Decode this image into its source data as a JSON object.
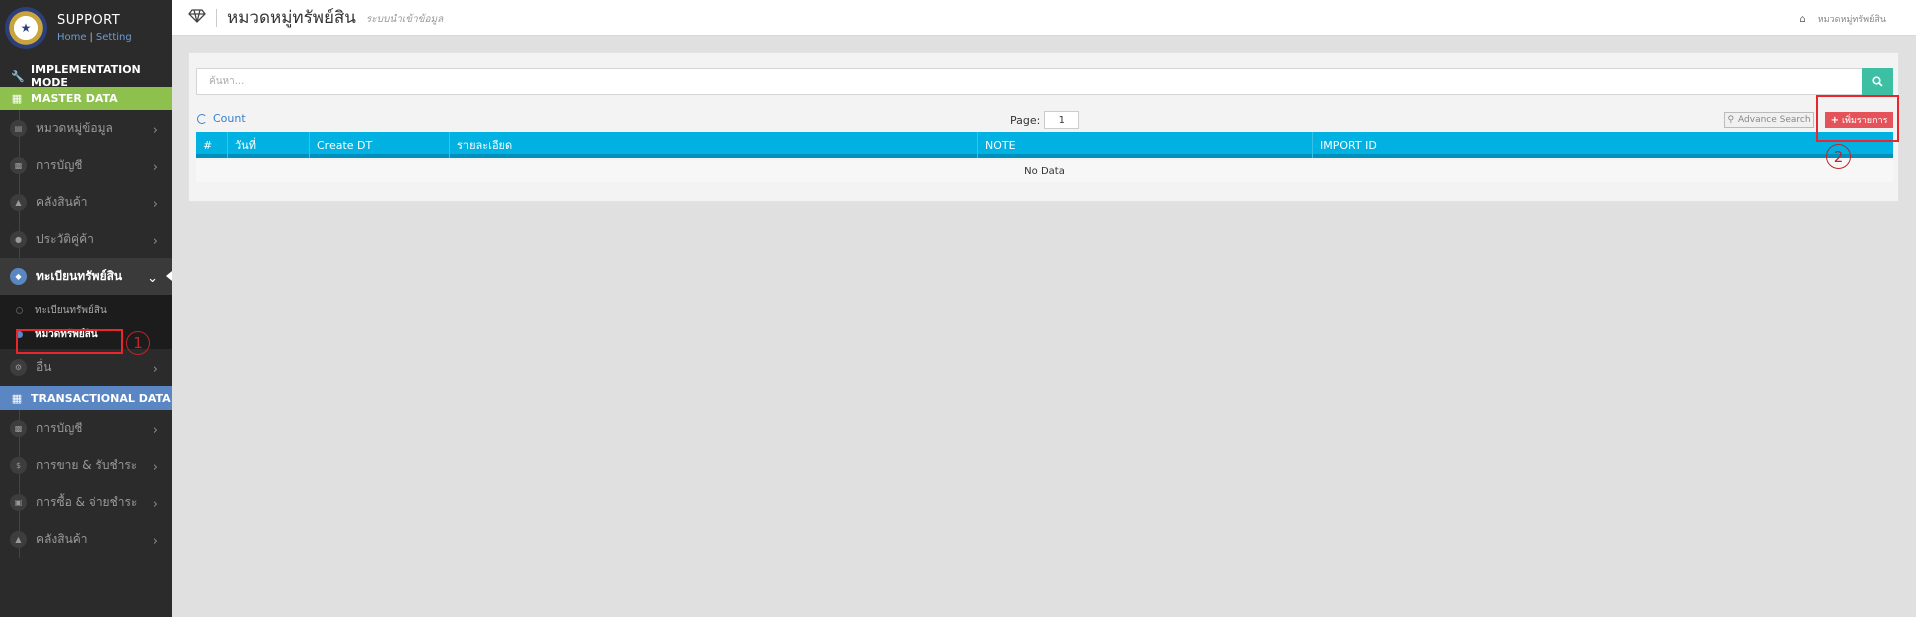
{
  "brand": {
    "title": "SUPPORT",
    "link_home": "Home",
    "link_setting": "Setting",
    "separator": "|"
  },
  "sidebar": {
    "implementation_label": "IMPLEMENTATION MODE",
    "master_label": "MASTER DATA",
    "master_items": [
      {
        "label": "หมวดหมู่ข้อมูล",
        "icon": "database-icon"
      },
      {
        "label": "การบัญชี",
        "icon": "book-icon"
      },
      {
        "label": "คลังสินค้า",
        "icon": "cubes-icon"
      },
      {
        "label": "ประวัติคู่ค้า",
        "icon": "user-icon"
      },
      {
        "label": "ทะเบียนทรัพย์สิน",
        "icon": "diamond-icon",
        "active": true
      }
    ],
    "submenu": [
      {
        "label": "ทะเบียนทรัพย์สิน"
      },
      {
        "label": "หมวดทรัพย์สิน",
        "current": true
      }
    ],
    "other_label": "อื่น",
    "transactional_label": "TRANSACTIONAL DATA",
    "trans_items": [
      {
        "label": "การบัญชี",
        "icon": "book-icon"
      },
      {
        "label": "การขาย & รับชำระ",
        "icon": "dollar-icon"
      },
      {
        "label": "การซื้อ & จ่ายชำระ",
        "icon": "cart-icon"
      },
      {
        "label": "คลังสินค้า",
        "icon": "cubes-icon"
      }
    ]
  },
  "header": {
    "title": "หมวดหมู่ทรัพย์สิน",
    "subtitle": "ระบบนำเข้าข้อมูล",
    "breadcrumb": "หมวดหมู่ทรัพย์สิน"
  },
  "toolbar": {
    "search_placeholder": "ค้นหา...",
    "count_label": "Count",
    "page_label": "Page:",
    "page_value": "1",
    "advance_search_label": "Advance Search",
    "add_label": "เพิ่มรายการ"
  },
  "table": {
    "columns": [
      "#",
      "วันที่",
      "Create DT",
      "รายละเอียด",
      "NOTE",
      "IMPORT ID"
    ],
    "empty_text": "No Data"
  },
  "annotations": {
    "marker_1": "1",
    "marker_2": "2"
  },
  "colors": {
    "sidebar_bg": "#2b2b2b",
    "master_green": "#8dc04d",
    "transactional_blue": "#5a86c4",
    "table_header": "#00b1e1",
    "search_button": "#3dbfa3",
    "add_button": "#e5535a",
    "annotation_red": "#e8262b"
  }
}
